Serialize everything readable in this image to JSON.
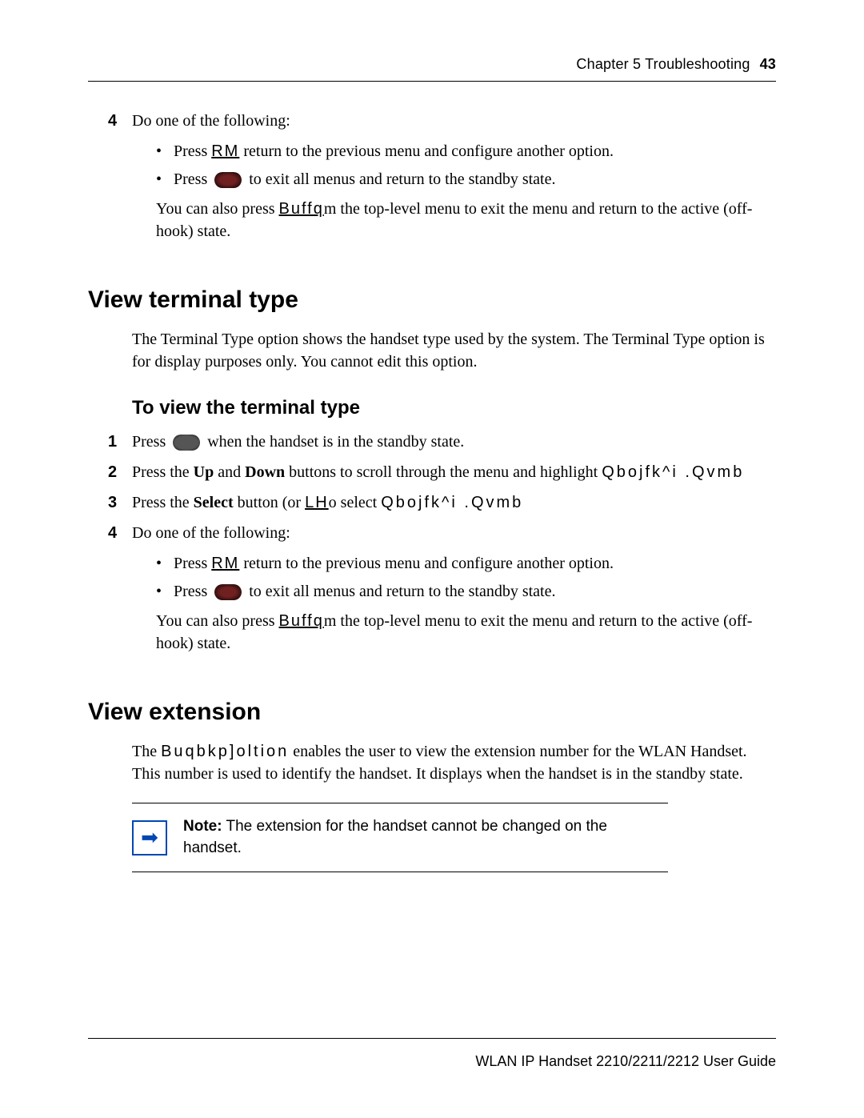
{
  "header": {
    "chapter": "Chapter 5  Troubleshooting",
    "page": "43"
  },
  "top": {
    "step4": {
      "num": "4",
      "text": "Do one of the following:"
    },
    "bullets": {
      "a1": "Press ",
      "aKey": "RM",
      "a2": " return to the previous menu and configure another option.",
      "b1": "Press ",
      "b2": " to exit all menus and return to the standby state."
    },
    "para": {
      "a": "You can also press ",
      "key": "Buffq",
      "b": "m the top-level menu to exit the menu and return to the active (off-hook) state."
    }
  },
  "sec1": {
    "title": "View terminal type",
    "intro": "The Terminal Type option shows the handset type used by the system. The Terminal Type option is for display purposes only. You cannot edit this option.",
    "subtitle": "To view the terminal type",
    "s1": {
      "num": "1",
      "a": "Press ",
      "b": " when the handset is in the standby state."
    },
    "s2": {
      "num": "2",
      "a": "Press the ",
      "up": "Up",
      "and": " and ",
      "down": "Down",
      "b": " buttons to scroll through the menu and highlight ",
      "menu": "Qbojfk^i .Qvmb"
    },
    "s3": {
      "num": "3",
      "a": "Press the ",
      "sel": "Select",
      "b": " button (or ",
      "key": "LH",
      "c": "o select ",
      "menu": "Qbojfk^i .Qvmb"
    },
    "s4": {
      "num": "4",
      "text": "Do one of the following:"
    },
    "bullets": {
      "a1": "Press ",
      "aKey": "RM",
      "a2": " return to the previous menu and configure another option.",
      "b1": "Press ",
      "b2": " to exit all menus and return to the standby state."
    },
    "para": {
      "a": "You can also press ",
      "key": "Buffq",
      "b": "m the top-level menu to exit the menu and return to the active (off-hook) state."
    }
  },
  "sec2": {
    "title": "View extension",
    "intro": {
      "a": "The ",
      "key": "Buqbkp]oltion",
      "b": " enables the user to view the extension number for the WLAN Handset. This number is used to identify the handset. It displays when the handset is in the standby state."
    },
    "noteLabel": "Note:",
    "noteText": " The extension for the handset cannot be changed on the handset."
  },
  "footer": {
    "text": "WLAN IP Handset 2210/2211/2212 User Guide"
  }
}
